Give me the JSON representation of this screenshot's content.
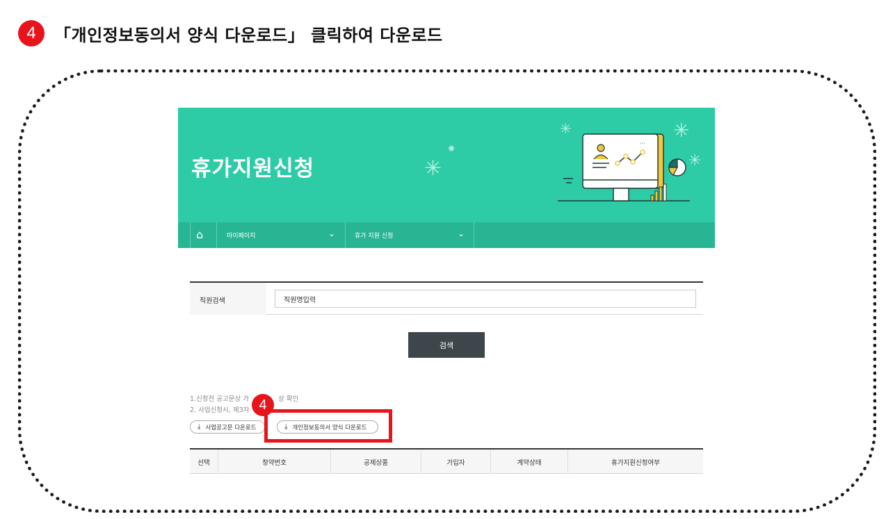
{
  "instruction": {
    "step": "4",
    "text": "「개인정보동의서 양식 다운로드」 클릭하여 다운로드"
  },
  "banner": {
    "title": "휴가지원신청"
  },
  "nav": {
    "home_icon": "home-icon",
    "items": [
      {
        "label": "마이페이지"
      },
      {
        "label": "휴가 지원 신청"
      }
    ]
  },
  "search": {
    "label": "직원검색",
    "value": "직원명입력",
    "button": "검색"
  },
  "notes": [
    "1.신청전 공고문상 가",
    "상 확인",
    "2. 사업신청시, 제3자"
  ],
  "downloads": {
    "notice": "사업공고문 다운로드",
    "consent": "개인정보동의서 양식 다운로드",
    "icon": "download-icon"
  },
  "callout": {
    "step": "4",
    "color": "#e8141b"
  },
  "table": {
    "columns": [
      "선택",
      "청약번호",
      "공제상품",
      "가입자",
      "계약상태",
      "휴가지원신청여부"
    ]
  },
  "colors": {
    "banner": "#2ecba7",
    "navbar": "#28b593",
    "search_button": "#3d474b",
    "accent_red": "#e8141b"
  }
}
